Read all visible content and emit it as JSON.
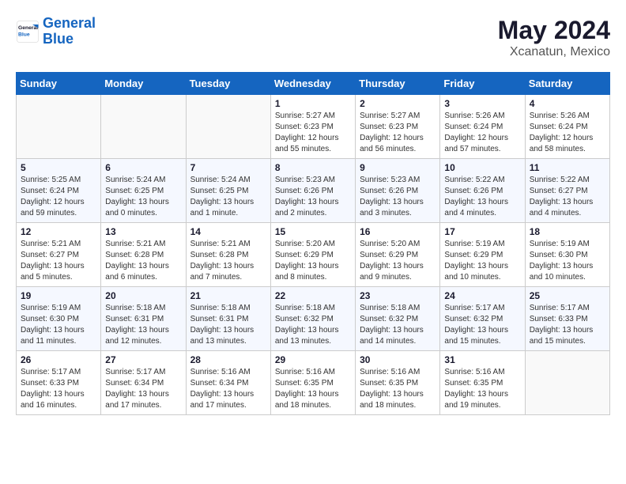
{
  "header": {
    "logo_line1": "General",
    "logo_line2": "Blue",
    "title": "May 2024",
    "subtitle": "Xcanatun, Mexico"
  },
  "weekdays": [
    "Sunday",
    "Monday",
    "Tuesday",
    "Wednesday",
    "Thursday",
    "Friday",
    "Saturday"
  ],
  "weeks": [
    [
      {
        "day": "",
        "info": ""
      },
      {
        "day": "",
        "info": ""
      },
      {
        "day": "",
        "info": ""
      },
      {
        "day": "1",
        "info": "Sunrise: 5:27 AM\nSunset: 6:23 PM\nDaylight: 12 hours\nand 55 minutes."
      },
      {
        "day": "2",
        "info": "Sunrise: 5:27 AM\nSunset: 6:23 PM\nDaylight: 12 hours\nand 56 minutes."
      },
      {
        "day": "3",
        "info": "Sunrise: 5:26 AM\nSunset: 6:24 PM\nDaylight: 12 hours\nand 57 minutes."
      },
      {
        "day": "4",
        "info": "Sunrise: 5:26 AM\nSunset: 6:24 PM\nDaylight: 12 hours\nand 58 minutes."
      }
    ],
    [
      {
        "day": "5",
        "info": "Sunrise: 5:25 AM\nSunset: 6:24 PM\nDaylight: 12 hours\nand 59 minutes."
      },
      {
        "day": "6",
        "info": "Sunrise: 5:24 AM\nSunset: 6:25 PM\nDaylight: 13 hours\nand 0 minutes."
      },
      {
        "day": "7",
        "info": "Sunrise: 5:24 AM\nSunset: 6:25 PM\nDaylight: 13 hours\nand 1 minute."
      },
      {
        "day": "8",
        "info": "Sunrise: 5:23 AM\nSunset: 6:26 PM\nDaylight: 13 hours\nand 2 minutes."
      },
      {
        "day": "9",
        "info": "Sunrise: 5:23 AM\nSunset: 6:26 PM\nDaylight: 13 hours\nand 3 minutes."
      },
      {
        "day": "10",
        "info": "Sunrise: 5:22 AM\nSunset: 6:26 PM\nDaylight: 13 hours\nand 4 minutes."
      },
      {
        "day": "11",
        "info": "Sunrise: 5:22 AM\nSunset: 6:27 PM\nDaylight: 13 hours\nand 4 minutes."
      }
    ],
    [
      {
        "day": "12",
        "info": "Sunrise: 5:21 AM\nSunset: 6:27 PM\nDaylight: 13 hours\nand 5 minutes."
      },
      {
        "day": "13",
        "info": "Sunrise: 5:21 AM\nSunset: 6:28 PM\nDaylight: 13 hours\nand 6 minutes."
      },
      {
        "day": "14",
        "info": "Sunrise: 5:21 AM\nSunset: 6:28 PM\nDaylight: 13 hours\nand 7 minutes."
      },
      {
        "day": "15",
        "info": "Sunrise: 5:20 AM\nSunset: 6:29 PM\nDaylight: 13 hours\nand 8 minutes."
      },
      {
        "day": "16",
        "info": "Sunrise: 5:20 AM\nSunset: 6:29 PM\nDaylight: 13 hours\nand 9 minutes."
      },
      {
        "day": "17",
        "info": "Sunrise: 5:19 AM\nSunset: 6:29 PM\nDaylight: 13 hours\nand 10 minutes."
      },
      {
        "day": "18",
        "info": "Sunrise: 5:19 AM\nSunset: 6:30 PM\nDaylight: 13 hours\nand 10 minutes."
      }
    ],
    [
      {
        "day": "19",
        "info": "Sunrise: 5:19 AM\nSunset: 6:30 PM\nDaylight: 13 hours\nand 11 minutes."
      },
      {
        "day": "20",
        "info": "Sunrise: 5:18 AM\nSunset: 6:31 PM\nDaylight: 13 hours\nand 12 minutes."
      },
      {
        "day": "21",
        "info": "Sunrise: 5:18 AM\nSunset: 6:31 PM\nDaylight: 13 hours\nand 13 minutes."
      },
      {
        "day": "22",
        "info": "Sunrise: 5:18 AM\nSunset: 6:32 PM\nDaylight: 13 hours\nand 13 minutes."
      },
      {
        "day": "23",
        "info": "Sunrise: 5:18 AM\nSunset: 6:32 PM\nDaylight: 13 hours\nand 14 minutes."
      },
      {
        "day": "24",
        "info": "Sunrise: 5:17 AM\nSunset: 6:32 PM\nDaylight: 13 hours\nand 15 minutes."
      },
      {
        "day": "25",
        "info": "Sunrise: 5:17 AM\nSunset: 6:33 PM\nDaylight: 13 hours\nand 15 minutes."
      }
    ],
    [
      {
        "day": "26",
        "info": "Sunrise: 5:17 AM\nSunset: 6:33 PM\nDaylight: 13 hours\nand 16 minutes."
      },
      {
        "day": "27",
        "info": "Sunrise: 5:17 AM\nSunset: 6:34 PM\nDaylight: 13 hours\nand 17 minutes."
      },
      {
        "day": "28",
        "info": "Sunrise: 5:16 AM\nSunset: 6:34 PM\nDaylight: 13 hours\nand 17 minutes."
      },
      {
        "day": "29",
        "info": "Sunrise: 5:16 AM\nSunset: 6:35 PM\nDaylight: 13 hours\nand 18 minutes."
      },
      {
        "day": "30",
        "info": "Sunrise: 5:16 AM\nSunset: 6:35 PM\nDaylight: 13 hours\nand 18 minutes."
      },
      {
        "day": "31",
        "info": "Sunrise: 5:16 AM\nSunset: 6:35 PM\nDaylight: 13 hours\nand 19 minutes."
      },
      {
        "day": "",
        "info": ""
      }
    ]
  ]
}
